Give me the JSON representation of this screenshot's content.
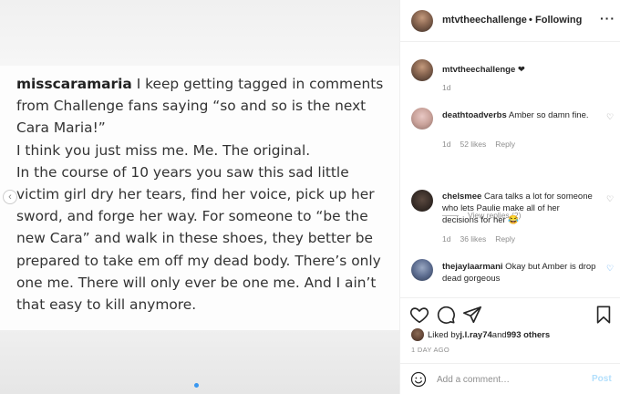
{
  "post_image": {
    "caption_handle": "misscaramaria",
    "caption_first": " I keep getting tagged in comments from Challenge fans saying “so and so is the next Cara Maria!”",
    "caption_line2": "I think you just miss me. Me. The original.",
    "caption_line3": "In the course of 10 years you saw this sad little victim girl dry her tears, find her voice, pick up her sword, and forge her way. For someone to “be the new Cara” and walk in these shoes, they better be prepared to take em off my dead body. There’s only one me. There will only ever be one me. And I ain’t that easy to kill anymore."
  },
  "header": {
    "username": "mtvtheechallenge",
    "separator": "•",
    "follow_status": "Following",
    "more": "···"
  },
  "comments": [
    {
      "user": "mtvtheechallenge",
      "text": " ❤",
      "time": "1d",
      "likes": "",
      "reply": ""
    },
    {
      "user": "deathtoadverbs",
      "text": " Amber so damn fine.",
      "time": "1d",
      "likes": "52 likes",
      "reply": "Reply"
    },
    {
      "user": "chelsmee",
      "text": " Cara talks a lot for someone who lets Paulie make all of her decisions for her 😂",
      "time": "1d",
      "likes": "36 likes",
      "reply": "Reply"
    },
    {
      "user": "thejaylaarmani",
      "text": " Okay but Amber is drop dead gorgeous",
      "time": "",
      "likes": "",
      "reply": ""
    }
  ],
  "view_replies": "View replies (2)",
  "likes": {
    "prefix": "Liked by ",
    "user": "j.l.ray74",
    "middle": " and ",
    "others": "993 others"
  },
  "date": "1 DAY AGO",
  "add_comment": {
    "placeholder": "Add a comment…",
    "post_label": "Post"
  },
  "icons": {
    "like": "heart-icon",
    "comment": "speech-bubble-icon",
    "share": "paper-plane-icon",
    "save": "bookmark-icon",
    "emoji": "smiley-icon"
  }
}
